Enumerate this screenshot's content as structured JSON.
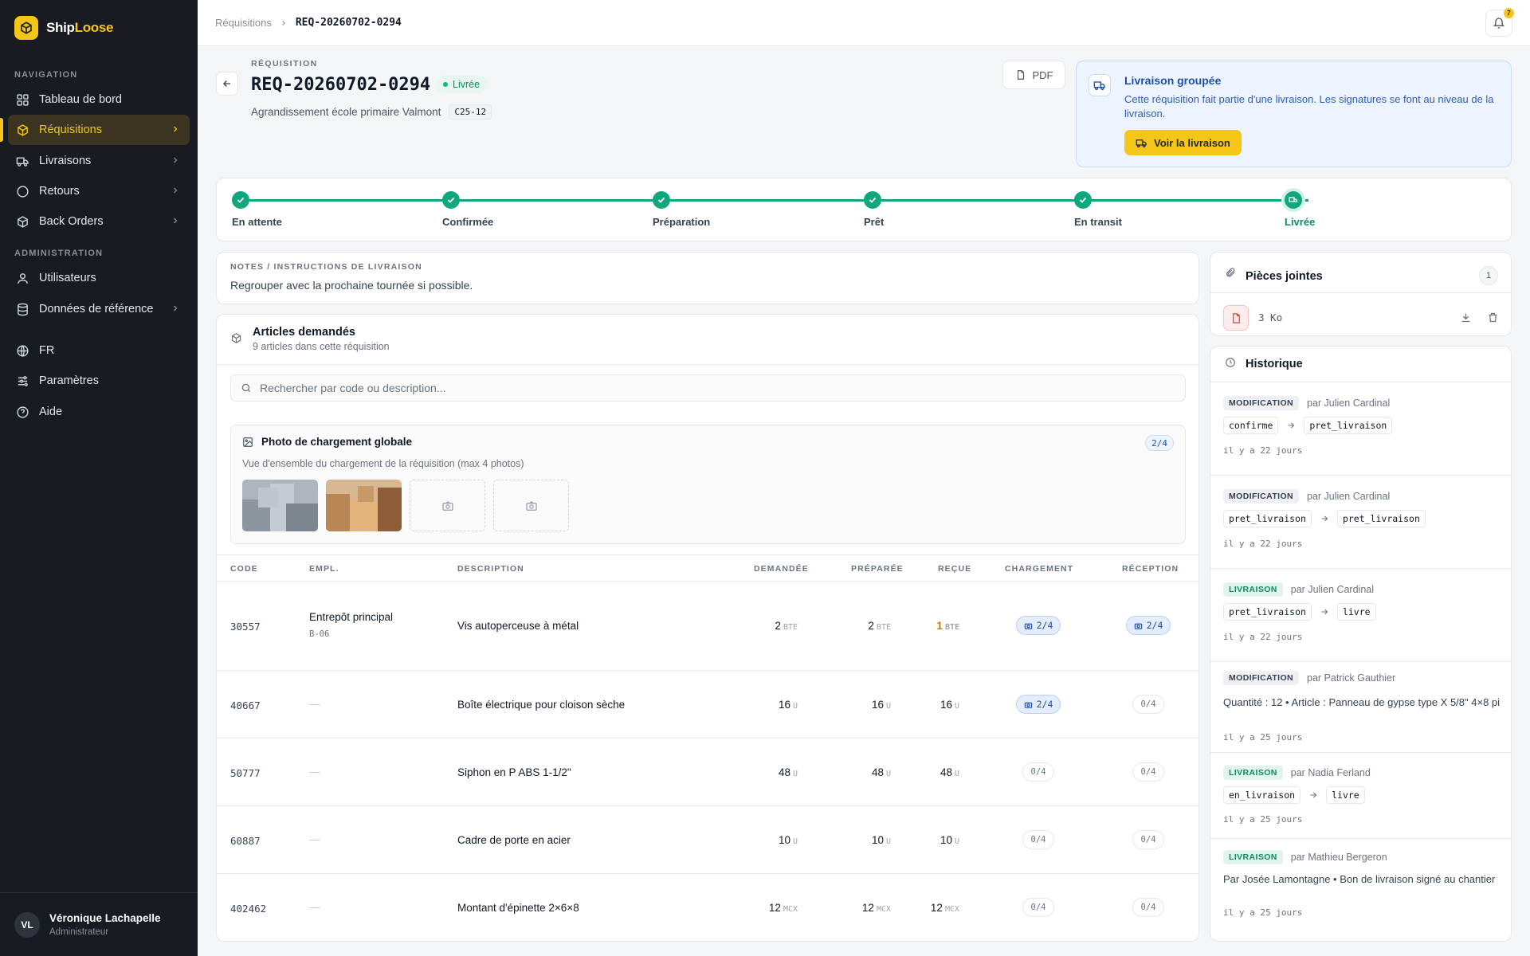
{
  "brand": {
    "name_a": "Ship",
    "name_b": "Loose"
  },
  "sidebar": {
    "section_nav": "NAVIGATION",
    "section_admin": "ADMINISTRATION",
    "items": [
      {
        "label": "Tableau de bord",
        "icon": "dashboard-icon"
      },
      {
        "label": "Réquisitions",
        "icon": "box-icon"
      },
      {
        "label": "Livraisons",
        "icon": "truck-icon"
      },
      {
        "label": "Retours",
        "icon": "return-icon"
      },
      {
        "label": "Back Orders",
        "icon": "package-icon"
      },
      {
        "label": "Utilisateurs",
        "icon": "user-icon"
      },
      {
        "label": "Données de référence",
        "icon": "database-icon"
      },
      {
        "label": "FR",
        "icon": "globe-icon"
      },
      {
        "label": "Paramètres",
        "icon": "sliders-icon"
      },
      {
        "label": "Aide",
        "icon": "help-icon"
      }
    ],
    "user": {
      "initials": "VL",
      "name": "Véronique Lachapelle",
      "role": "Administrateur"
    }
  },
  "topbar": {
    "crumb_root": "Réquisitions",
    "crumb_current": "REQ-20260702-0294",
    "notif_count": "7"
  },
  "header": {
    "kicker": "RÉQUISITION",
    "title": "REQ-20260702-0294",
    "status": "Livrée",
    "project": "Agrandissement école primaire Valmont",
    "project_code": "C25-12",
    "pdf_label": "PDF"
  },
  "group_delivery": {
    "title": "Livraison groupée",
    "text": "Cette réquisition fait partie d'une livraison. Les signatures se font au niveau de la livraison.",
    "button": "Voir la livraison"
  },
  "steps": [
    "En attente",
    "Confirmée",
    "Préparation",
    "Prêt",
    "En transit",
    "Livrée"
  ],
  "notes": {
    "label": "NOTES / INSTRUCTIONS DE LIVRAISON",
    "text": "Regrouper avec la prochaine tournée si possible."
  },
  "articles": {
    "title": "Articles demandés",
    "subtitle": "9 articles dans cette réquisition",
    "search_placeholder": "Rechercher par code ou description...",
    "photo": {
      "title": "Photo de chargement globale",
      "subtitle": "Vue d'ensemble du chargement de la réquisition (max 4 photos)",
      "count": "2/4"
    },
    "columns": [
      "CODE",
      "EMPL.",
      "DESCRIPTION",
      "DEMANDÉE",
      "PRÉPARÉE",
      "REÇUE",
      "CHARGEMENT",
      "RÉCEPTION"
    ],
    "rows": [
      {
        "code": "30557",
        "loc": "Entrepôt principal",
        "loc_sub": "B-06",
        "desc": "Vis autoperceuse à métal",
        "dem": "2",
        "dem_u": "BTE",
        "prep": "2",
        "prep_u": "BTE",
        "rec": "1",
        "rec_u": "BTE",
        "charg": "2/4",
        "recep": "2/4"
      },
      {
        "code": "40667",
        "loc": "—",
        "loc_sub": "",
        "desc": "Boîte électrique pour cloison sèche",
        "dem": "16",
        "dem_u": "U",
        "prep": "16",
        "prep_u": "U",
        "rec": "16",
        "rec_u": "U",
        "charg": "2/4",
        "recep": "0/4"
      },
      {
        "code": "50777",
        "loc": "—",
        "loc_sub": "",
        "desc": "Siphon en P ABS 1-1/2\"",
        "dem": "48",
        "dem_u": "U",
        "prep": "48",
        "prep_u": "U",
        "rec": "48",
        "rec_u": "U",
        "charg": "0/4",
        "recep": "0/4"
      },
      {
        "code": "60887",
        "loc": "—",
        "loc_sub": "",
        "desc": "Cadre de porte en acier",
        "dem": "10",
        "dem_u": "U",
        "prep": "10",
        "prep_u": "U",
        "rec": "10",
        "rec_u": "U",
        "charg": "0/4",
        "recep": "0/4"
      },
      {
        "code": "402462",
        "loc": "—",
        "loc_sub": "",
        "desc": "Montant d'épinette 2×6×8",
        "dem": "12",
        "dem_u": "MCX",
        "prep": "12",
        "prep_u": "MCX",
        "rec": "12",
        "rec_u": "MCX",
        "charg": "0/4",
        "recep": "0/4"
      }
    ]
  },
  "attachments": {
    "title": "Pièces jointes",
    "count": "1",
    "file_size": "3 Ko"
  },
  "history": {
    "title": "Historique",
    "items": [
      {
        "badge": "MODIFICATION",
        "by": "par Julien Cardinal",
        "from": "confirme",
        "to": "pret_livraison",
        "time": "il y a 22 jours"
      },
      {
        "badge": "MODIFICATION",
        "by": "par Julien Cardinal",
        "from": "pret_livraison",
        "to": "pret_livraison",
        "time": "il y a 22 jours"
      },
      {
        "badge": "LIVRAISON",
        "by": "par Julien Cardinal",
        "from": "pret_livraison",
        "to": "livre",
        "time": "il y a 22 jours"
      },
      {
        "badge": "MODIFICATION",
        "by": "par Patrick Gauthier",
        "text": "Quantité : 12 • Article : Panneau de gypse type X 5/8\" 4×8 pi",
        "time": "il y a 25 jours"
      },
      {
        "badge": "LIVRAISON",
        "by": "par Nadia Ferland",
        "from": "en_livraison",
        "to": "livre",
        "time": "il y a 25 jours"
      },
      {
        "badge": "LIVRAISON",
        "by": "par Mathieu Bergeron",
        "text": "Par Josée Lamontagne • Bon de livraison signé au chantier",
        "time": "il y a 25 jours"
      }
    ]
  }
}
